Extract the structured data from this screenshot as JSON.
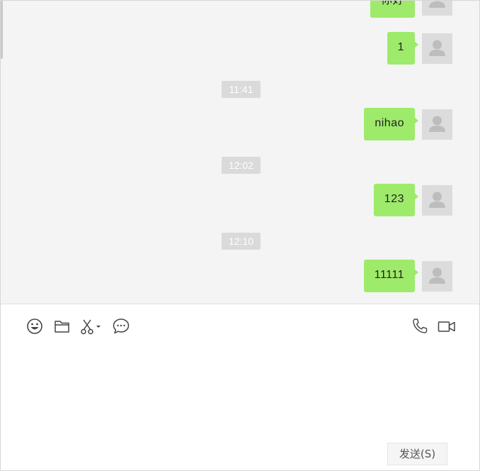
{
  "messages": [
    {
      "text": "你好",
      "time_before": ""
    },
    {
      "text": "1",
      "time_before": ""
    },
    {
      "text": "nihao",
      "time_before": "11:41"
    },
    {
      "text": "123",
      "time_before": "12:02"
    },
    {
      "text": "11111",
      "time_before": "12:10"
    }
  ],
  "toolbar": {
    "left_icons": [
      "emoji-icon",
      "folder-icon",
      "scissors-icon",
      "chat-bubble-icon"
    ],
    "right_icons": [
      "phone-icon",
      "video-camera-icon"
    ]
  },
  "composer": {
    "value": "",
    "send_label": "发送(S)"
  },
  "colors": {
    "bubble": "#9eea6a",
    "chat_background": "#f4f4f4",
    "time_chip": "#dadada",
    "avatar_placeholder": "#dcdcdc"
  }
}
